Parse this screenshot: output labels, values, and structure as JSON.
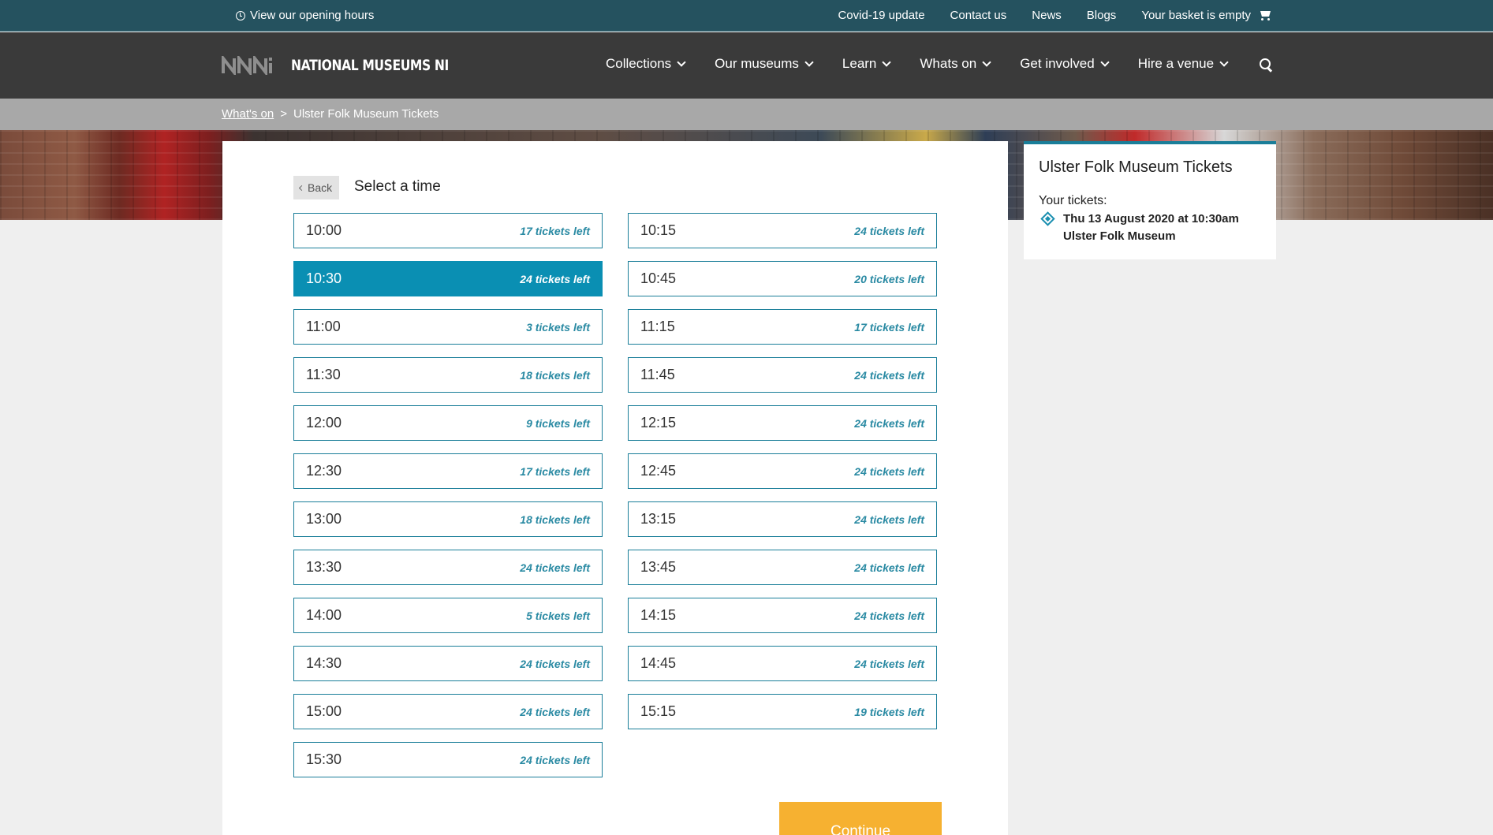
{
  "topbar": {
    "hours_label": "View our opening hours",
    "links": [
      "Covid-19 update",
      "Contact us",
      "News",
      "Blogs"
    ],
    "basket_label": "Your basket is empty"
  },
  "nav": {
    "logo_text": "NATIONAL MUSEUMS NI",
    "items": [
      "Collections",
      "Our museums",
      "Learn",
      "Whats on",
      "Get involved",
      "Hire a venue"
    ]
  },
  "breadcrumb": {
    "link": "What's on",
    "separator": ">",
    "current": "Ulster Folk Museum Tickets"
  },
  "main": {
    "back_label": "Back",
    "title": "Select a time",
    "slots": [
      {
        "time": "10:00",
        "left": "17 tickets left"
      },
      {
        "time": "10:15",
        "left": "24 tickets left"
      },
      {
        "time": "10:30",
        "left": "24 tickets left",
        "selected": true
      },
      {
        "time": "10:45",
        "left": "20 tickets left"
      },
      {
        "time": "11:00",
        "left": "3 tickets left"
      },
      {
        "time": "11:15",
        "left": "17 tickets left"
      },
      {
        "time": "11:30",
        "left": "18 tickets left"
      },
      {
        "time": "11:45",
        "left": "24 tickets left"
      },
      {
        "time": "12:00",
        "left": "9 tickets left"
      },
      {
        "time": "12:15",
        "left": "24 tickets left"
      },
      {
        "time": "12:30",
        "left": "17 tickets left"
      },
      {
        "time": "12:45",
        "left": "24 tickets left"
      },
      {
        "time": "13:00",
        "left": "18 tickets left"
      },
      {
        "time": "13:15",
        "left": "24 tickets left"
      },
      {
        "time": "13:30",
        "left": "24 tickets left"
      },
      {
        "time": "13:45",
        "left": "24 tickets left"
      },
      {
        "time": "14:00",
        "left": "5 tickets left"
      },
      {
        "time": "14:15",
        "left": "24 tickets left"
      },
      {
        "time": "14:30",
        "left": "24 tickets left"
      },
      {
        "time": "14:45",
        "left": "24 tickets left"
      },
      {
        "time": "15:00",
        "left": "24 tickets left"
      },
      {
        "time": "15:15",
        "left": "19 tickets left"
      },
      {
        "time": "15:30",
        "left": "24 tickets left"
      }
    ],
    "continue_label": "Continue"
  },
  "sidebar": {
    "title": "Ulster Folk Museum Tickets",
    "label": "Your tickets:",
    "ticket_date": "Thu 13 August 2020 at 10:30am",
    "ticket_venue": "Ulster Folk Museum"
  },
  "colors": {
    "topbar": "#25525f",
    "nav": "#3a3a3a",
    "accent": "#0a8fb3",
    "continue": "#f6b131"
  }
}
